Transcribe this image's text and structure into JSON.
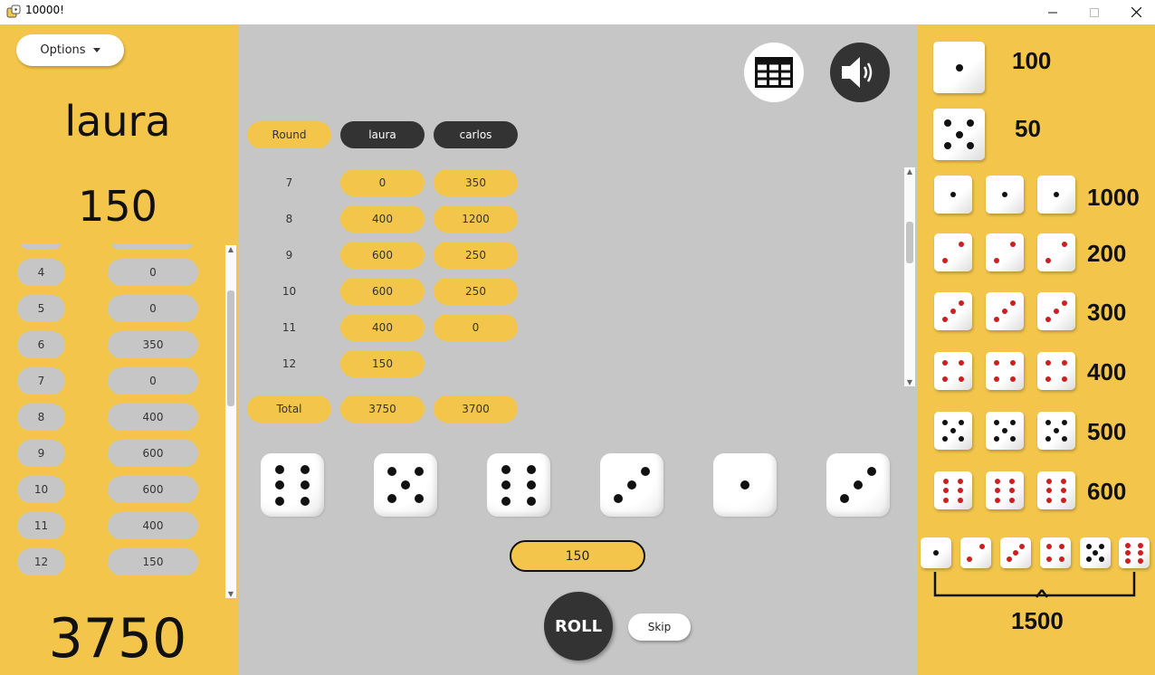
{
  "window": {
    "title": "10000!"
  },
  "left_panel": {
    "options_label": "Options",
    "player_name": "laura",
    "current_score": "150",
    "history": [
      {
        "round": "4",
        "score": "0"
      },
      {
        "round": "5",
        "score": "0"
      },
      {
        "round": "6",
        "score": "350"
      },
      {
        "round": "7",
        "score": "0"
      },
      {
        "round": "8",
        "score": "400"
      },
      {
        "round": "9",
        "score": "600"
      },
      {
        "round": "10",
        "score": "600"
      },
      {
        "round": "11",
        "score": "400"
      },
      {
        "round": "12",
        "score": "150"
      }
    ],
    "total_score": "3750"
  },
  "scoreboard": {
    "header": {
      "round": "Round",
      "players": [
        "laura",
        "carlos"
      ]
    },
    "rows": [
      {
        "round": "7",
        "laura": "0",
        "carlos": "350"
      },
      {
        "round": "8",
        "laura": "400",
        "carlos": "1200"
      },
      {
        "round": "9",
        "laura": "600",
        "carlos": "250"
      },
      {
        "round": "10",
        "laura": "600",
        "carlos": "250"
      },
      {
        "round": "11",
        "laura": "400",
        "carlos": "0"
      },
      {
        "round": "12",
        "laura": "150",
        "carlos": ""
      }
    ],
    "total": {
      "label": "Total",
      "laura": "3750",
      "carlos": "3700"
    }
  },
  "dice": [
    6,
    5,
    6,
    3,
    1,
    3
  ],
  "turn_score": "150",
  "roll_label": "ROLL",
  "skip_label": "Skip",
  "icons": {
    "table": "table-grid-icon",
    "sound": "speaker-icon"
  },
  "rules": [
    {
      "dice": [
        1
      ],
      "points": "100"
    },
    {
      "dice": [
        5
      ],
      "points": "50"
    },
    {
      "dice": [
        1,
        1,
        1
      ],
      "points": "1000"
    },
    {
      "dice": [
        2,
        2,
        2
      ],
      "points": "200"
    },
    {
      "dice": [
        3,
        3,
        3
      ],
      "points": "300"
    },
    {
      "dice": [
        4,
        4,
        4
      ],
      "points": "400"
    },
    {
      "dice": [
        5,
        5,
        5
      ],
      "points": "500"
    },
    {
      "dice": [
        6,
        6,
        6
      ],
      "points": "600"
    }
  ],
  "straight": {
    "dice": [
      1,
      2,
      3,
      4,
      5,
      6
    ],
    "points": "1500"
  },
  "colors": {
    "accent": "#F3C64B",
    "dark": "#333333",
    "grey": "#C6C6C6",
    "pip_black": "#111111",
    "pip_red": "#CC1F1F"
  }
}
